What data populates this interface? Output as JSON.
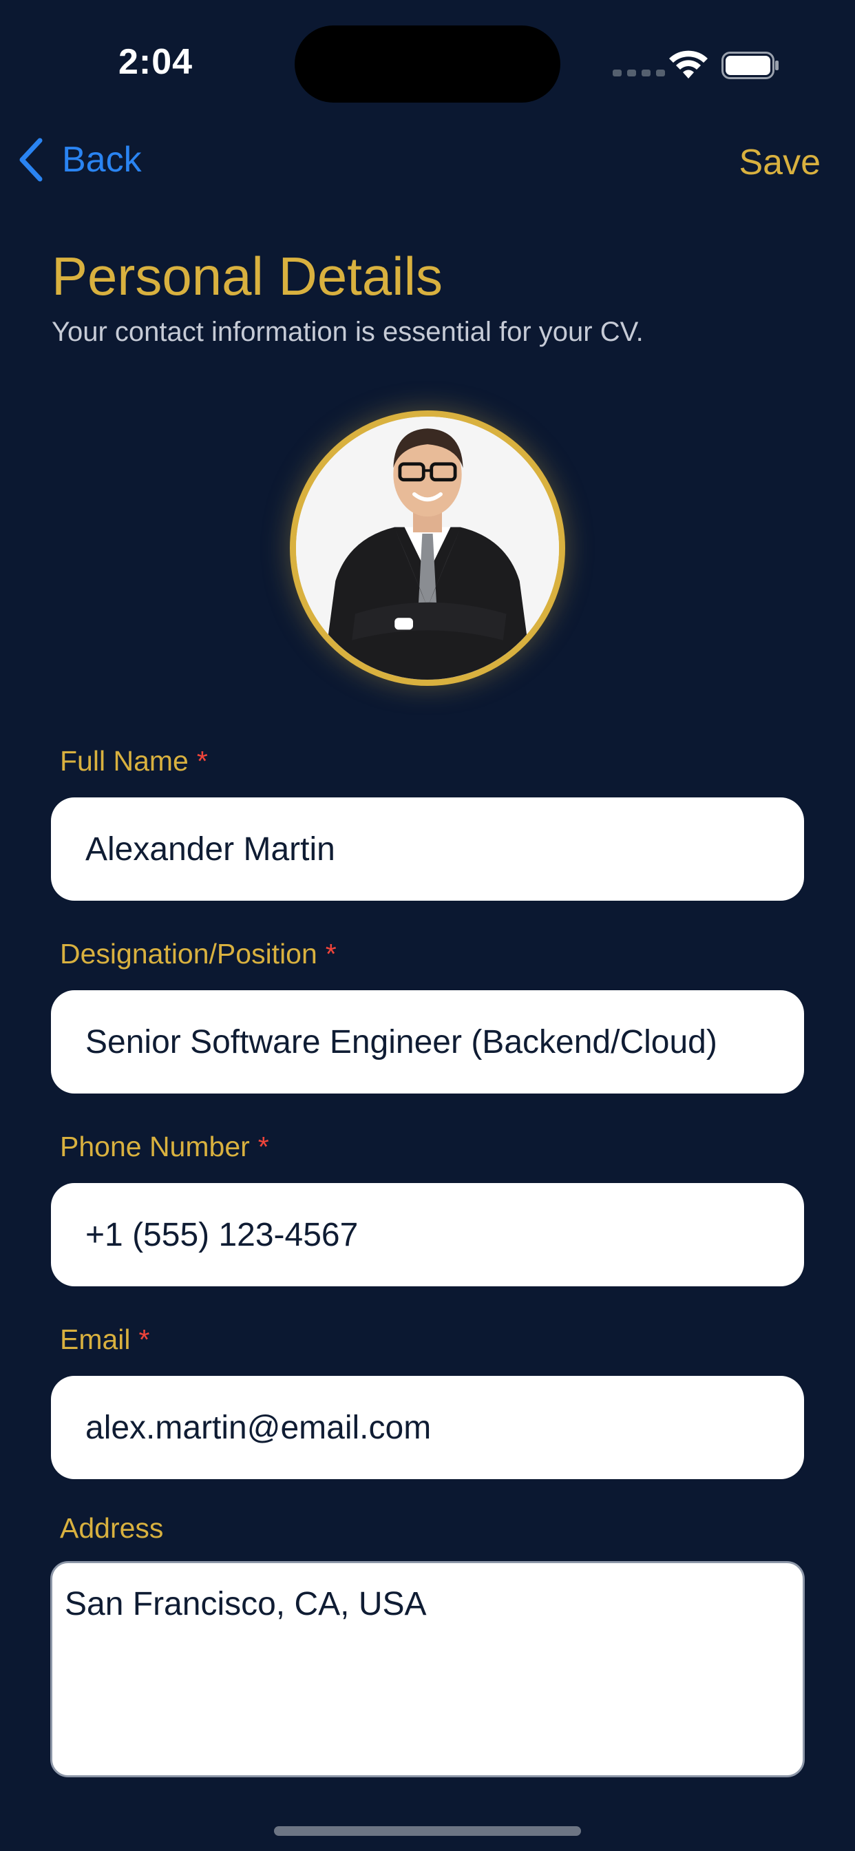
{
  "status_bar": {
    "time": "2:04"
  },
  "nav": {
    "back_label": "Back",
    "save_label": "Save"
  },
  "header": {
    "title": "Personal Details",
    "subtitle": "Your contact information is essential for your CV."
  },
  "form": {
    "full_name": {
      "label": "Full Name",
      "required_mark": "*",
      "value": "Alexander Martin"
    },
    "designation": {
      "label": "Designation/Position",
      "required_mark": "*",
      "value": "Senior Software Engineer (Backend/Cloud)"
    },
    "phone": {
      "label": "Phone Number",
      "required_mark": "*",
      "value": "+1 (555) 123-4567"
    },
    "email": {
      "label": "Email",
      "required_mark": "*",
      "value": "alex.martin@email.com"
    },
    "address": {
      "label": "Address",
      "value": "San Francisco, CA, USA"
    }
  },
  "icons": {
    "back": "chevron-left-icon",
    "wifi": "wifi-icon",
    "battery": "battery-icon",
    "signal": "cellular-signal-icon"
  },
  "colors": {
    "background": "#0b1831",
    "accent_gold": "#d9b13f",
    "link_blue": "#2a84f2",
    "required_red": "#f0443a",
    "input_text": "#0f1c33"
  }
}
